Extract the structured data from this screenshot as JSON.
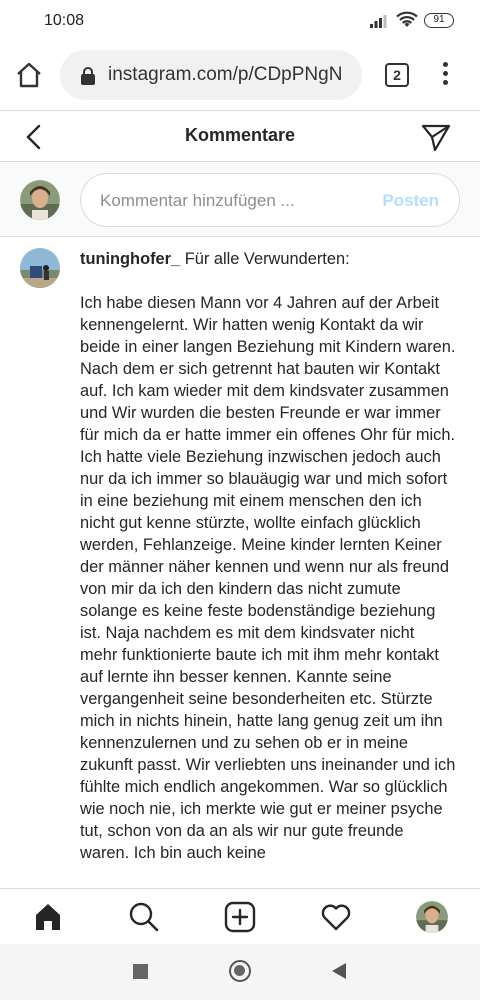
{
  "status_bar": {
    "time": "10:08",
    "battery": "91"
  },
  "browser": {
    "url": "instagram.com/p/CDpPNgN",
    "tab_count": "2"
  },
  "header": {
    "title": "Kommentare"
  },
  "comment_input": {
    "placeholder": "Kommentar hinzufügen ...",
    "post_label": "Posten"
  },
  "comment": {
    "username": "tuninghofer_",
    "first_line": "Für alle Verwunderten:",
    "text": "Ich habe diesen Mann vor 4 Jahren auf der Arbeit kennengelernt. Wir hatten wenig Kontakt da wir beide in einer langen Beziehung mit Kindern waren. Nach dem er sich getrennt hat bauten wir Kontakt auf. Ich kam wieder mit dem kindsvater zusammen und Wir wurden die besten Freunde er war immer für mich da er hatte immer ein offenes Ohr für mich. Ich hatte viele Beziehung inzwischen jedoch auch nur da ich immer so blauäugig war und mich sofort in eine beziehung mit einem menschen den ich nicht gut kenne stürzte, wollte einfach glücklich werden, Fehlanzeige. Meine kinder lernten Keiner der männer näher kennen und wenn nur als freund von mir da ich den kindern das nicht zumute solange es keine feste bodenständige beziehung ist. Naja nachdem es mit dem kindsvater nicht mehr funktionierte baute ich mit ihm mehr kontakt auf lernte ihn besser kennen. Kannte seine vergangenheit seine besonderheiten etc. Stürzte mich in nichts hinein, hatte lang genug zeit um ihn kennenzulernen und zu sehen ob er in meine zukunft passt. Wir verliebten uns ineinander und ich fühlte mich endlich angekommen. War so glücklich wie noch nie, ich merkte wie gut er meiner psyche tut, schon von da an als wir nur gute freunde waren. Ich bin auch keine"
  },
  "colors": {
    "accent_disabled": "#b2dffc",
    "text": "#262626",
    "secondary_text": "#8e8e8e",
    "divider": "#dbdbdb"
  },
  "icons": {
    "browser_home": "home-outline-icon",
    "lock": "lock-icon",
    "back": "chevron-left-icon",
    "direct": "paper-plane-icon",
    "nav_home": "home-filled-icon",
    "nav_search": "search-icon",
    "nav_new": "plus-square-icon",
    "nav_activity": "heart-icon"
  }
}
